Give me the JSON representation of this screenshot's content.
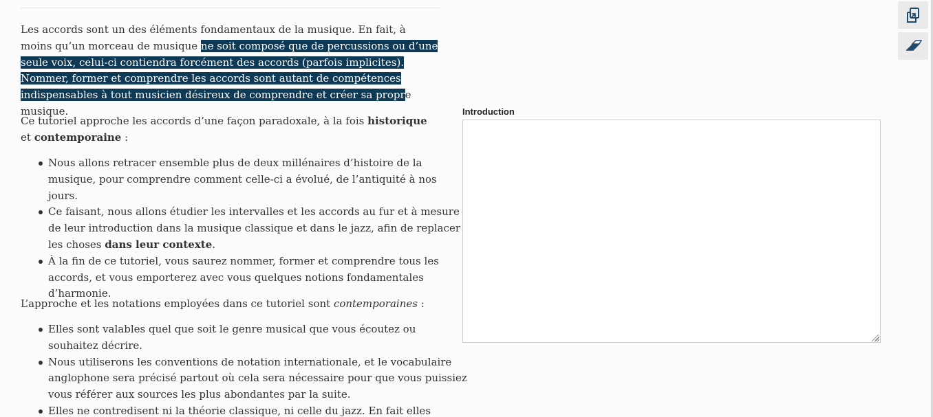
{
  "article": {
    "p1": {
      "before": "Les accords sont un des éléments fondamentaux de la musique. En fait, à moins qu’un morceau de musique ",
      "selected": "ne soit composé que de percussions ou d’une seule voix, celui-ci contiendra forcément des accords (parfois implicites). Nommer, former et comprendre les accords sont autant de compétences indispensables à tout musicien désireux de comprendre et créer sa propr",
      "after": "e musique."
    },
    "p2": {
      "t1": "Ce tutoriel approche les accords d’une façon paradoxale, à la fois ",
      "b1": "historique",
      "t2": " et ",
      "b2": "contemporaine",
      "t3": " :"
    },
    "list1": [
      {
        "text": "Nous allons retracer ensemble plus de deux millénaires d’histoire de la musique, pour comprendre comment celle-ci a évolué, de l’antiquité à nos jours."
      },
      {
        "text": "Ce faisant, nous allons étudier les intervalles et les accords au fur et à mesure de leur introduction dans la musique classique et dans le jazz, afin de replacer les choses ",
        "bold": "dans leur contexte",
        "after": "."
      },
      {
        "text": "À la fin de ce tutoriel, vous saurez nommer, former et comprendre tous les accords, et vous emporterez avec vous quelques notions fondamentales d’harmonie."
      }
    ],
    "p3": {
      "t1": "L’approche et les notations employées dans ce tutoriel sont ",
      "em": "contemporaines",
      "t2": " :"
    },
    "list2": [
      "Elles sont valables quel que soit le genre musical que vous écoutez ou souhaitez décrire.",
      "Nous utiliserons les conventions de notation internationale, et le vocabulaire anglophone sera précisé partout où cela sera nécessaire pour que vous puissiez vous référer aux sources les plus abondantes par la suite.",
      "Elles ne contredisent ni la théorie classique, ni celle du jazz. En fait elles"
    ]
  },
  "editor": {
    "label": "Introduction",
    "value": ""
  },
  "toolbar": {
    "copy_icon": "copy-icon",
    "eraser_icon": "eraser-icon"
  },
  "colors": {
    "selection_bg": "#0e3a56",
    "selection_text": "#ffffff",
    "icon": "#1e4a6e"
  }
}
